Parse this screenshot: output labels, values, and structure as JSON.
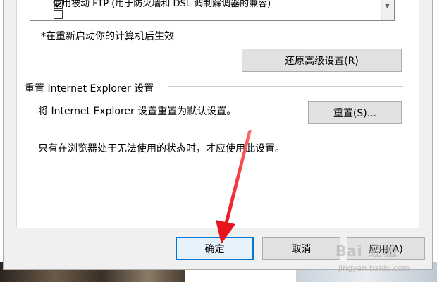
{
  "advanced_list": {
    "items": [
      {
        "label": "使用被动 FTP (用于防火墙和 DSL 调制解调器的兼容)",
        "checked": true
      },
      {
        "label": "",
        "checked": false
      }
    ]
  },
  "restart_note": "*在重新启动你的计算机后生效",
  "restore_button": "还原高级设置(R)",
  "reset_section": {
    "heading": "重置 Internet Explorer 设置",
    "description": "将 Internet Explorer 设置重置为默认设置。",
    "reset_button": "重置(S)...",
    "warning": "只有在浏览器处于无法使用的状态时，才应使用此设置。"
  },
  "footer": {
    "ok_label": "确定",
    "cancel_label": "取消",
    "apply_label": "应用(A)"
  },
  "watermark": {
    "brand": "Bai 经验",
    "url": "jingyan.baidu.com"
  },
  "annotation": {
    "arrow_color": "#e8141c"
  },
  "colors": {
    "focus_border": "#0078d7"
  }
}
